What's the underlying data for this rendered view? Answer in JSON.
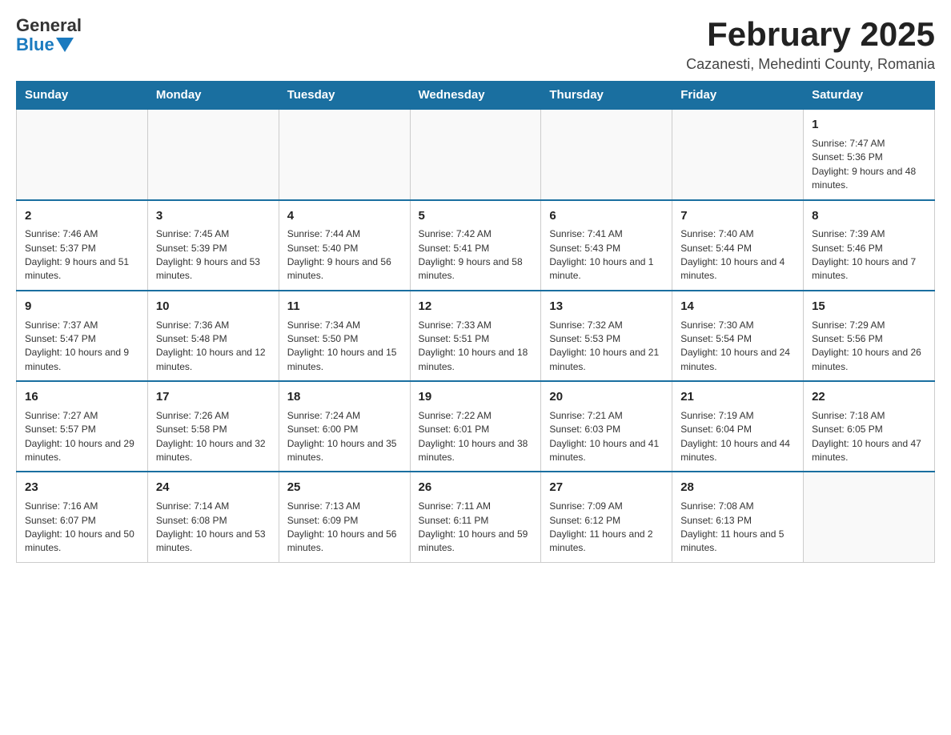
{
  "logo": {
    "general": "General",
    "blue": "Blue"
  },
  "title": "February 2025",
  "subtitle": "Cazanesti, Mehedinti County, Romania",
  "days_of_week": [
    "Sunday",
    "Monday",
    "Tuesday",
    "Wednesday",
    "Thursday",
    "Friday",
    "Saturday"
  ],
  "weeks": [
    [
      {
        "day": "",
        "info": ""
      },
      {
        "day": "",
        "info": ""
      },
      {
        "day": "",
        "info": ""
      },
      {
        "day": "",
        "info": ""
      },
      {
        "day": "",
        "info": ""
      },
      {
        "day": "",
        "info": ""
      },
      {
        "day": "1",
        "info": "Sunrise: 7:47 AM\nSunset: 5:36 PM\nDaylight: 9 hours and 48 minutes."
      }
    ],
    [
      {
        "day": "2",
        "info": "Sunrise: 7:46 AM\nSunset: 5:37 PM\nDaylight: 9 hours and 51 minutes."
      },
      {
        "day": "3",
        "info": "Sunrise: 7:45 AM\nSunset: 5:39 PM\nDaylight: 9 hours and 53 minutes."
      },
      {
        "day": "4",
        "info": "Sunrise: 7:44 AM\nSunset: 5:40 PM\nDaylight: 9 hours and 56 minutes."
      },
      {
        "day": "5",
        "info": "Sunrise: 7:42 AM\nSunset: 5:41 PM\nDaylight: 9 hours and 58 minutes."
      },
      {
        "day": "6",
        "info": "Sunrise: 7:41 AM\nSunset: 5:43 PM\nDaylight: 10 hours and 1 minute."
      },
      {
        "day": "7",
        "info": "Sunrise: 7:40 AM\nSunset: 5:44 PM\nDaylight: 10 hours and 4 minutes."
      },
      {
        "day": "8",
        "info": "Sunrise: 7:39 AM\nSunset: 5:46 PM\nDaylight: 10 hours and 7 minutes."
      }
    ],
    [
      {
        "day": "9",
        "info": "Sunrise: 7:37 AM\nSunset: 5:47 PM\nDaylight: 10 hours and 9 minutes."
      },
      {
        "day": "10",
        "info": "Sunrise: 7:36 AM\nSunset: 5:48 PM\nDaylight: 10 hours and 12 minutes."
      },
      {
        "day": "11",
        "info": "Sunrise: 7:34 AM\nSunset: 5:50 PM\nDaylight: 10 hours and 15 minutes."
      },
      {
        "day": "12",
        "info": "Sunrise: 7:33 AM\nSunset: 5:51 PM\nDaylight: 10 hours and 18 minutes."
      },
      {
        "day": "13",
        "info": "Sunrise: 7:32 AM\nSunset: 5:53 PM\nDaylight: 10 hours and 21 minutes."
      },
      {
        "day": "14",
        "info": "Sunrise: 7:30 AM\nSunset: 5:54 PM\nDaylight: 10 hours and 24 minutes."
      },
      {
        "day": "15",
        "info": "Sunrise: 7:29 AM\nSunset: 5:56 PM\nDaylight: 10 hours and 26 minutes."
      }
    ],
    [
      {
        "day": "16",
        "info": "Sunrise: 7:27 AM\nSunset: 5:57 PM\nDaylight: 10 hours and 29 minutes."
      },
      {
        "day": "17",
        "info": "Sunrise: 7:26 AM\nSunset: 5:58 PM\nDaylight: 10 hours and 32 minutes."
      },
      {
        "day": "18",
        "info": "Sunrise: 7:24 AM\nSunset: 6:00 PM\nDaylight: 10 hours and 35 minutes."
      },
      {
        "day": "19",
        "info": "Sunrise: 7:22 AM\nSunset: 6:01 PM\nDaylight: 10 hours and 38 minutes."
      },
      {
        "day": "20",
        "info": "Sunrise: 7:21 AM\nSunset: 6:03 PM\nDaylight: 10 hours and 41 minutes."
      },
      {
        "day": "21",
        "info": "Sunrise: 7:19 AM\nSunset: 6:04 PM\nDaylight: 10 hours and 44 minutes."
      },
      {
        "day": "22",
        "info": "Sunrise: 7:18 AM\nSunset: 6:05 PM\nDaylight: 10 hours and 47 minutes."
      }
    ],
    [
      {
        "day": "23",
        "info": "Sunrise: 7:16 AM\nSunset: 6:07 PM\nDaylight: 10 hours and 50 minutes."
      },
      {
        "day": "24",
        "info": "Sunrise: 7:14 AM\nSunset: 6:08 PM\nDaylight: 10 hours and 53 minutes."
      },
      {
        "day": "25",
        "info": "Sunrise: 7:13 AM\nSunset: 6:09 PM\nDaylight: 10 hours and 56 minutes."
      },
      {
        "day": "26",
        "info": "Sunrise: 7:11 AM\nSunset: 6:11 PM\nDaylight: 10 hours and 59 minutes."
      },
      {
        "day": "27",
        "info": "Sunrise: 7:09 AM\nSunset: 6:12 PM\nDaylight: 11 hours and 2 minutes."
      },
      {
        "day": "28",
        "info": "Sunrise: 7:08 AM\nSunset: 6:13 PM\nDaylight: 11 hours and 5 minutes."
      },
      {
        "day": "",
        "info": ""
      }
    ]
  ]
}
